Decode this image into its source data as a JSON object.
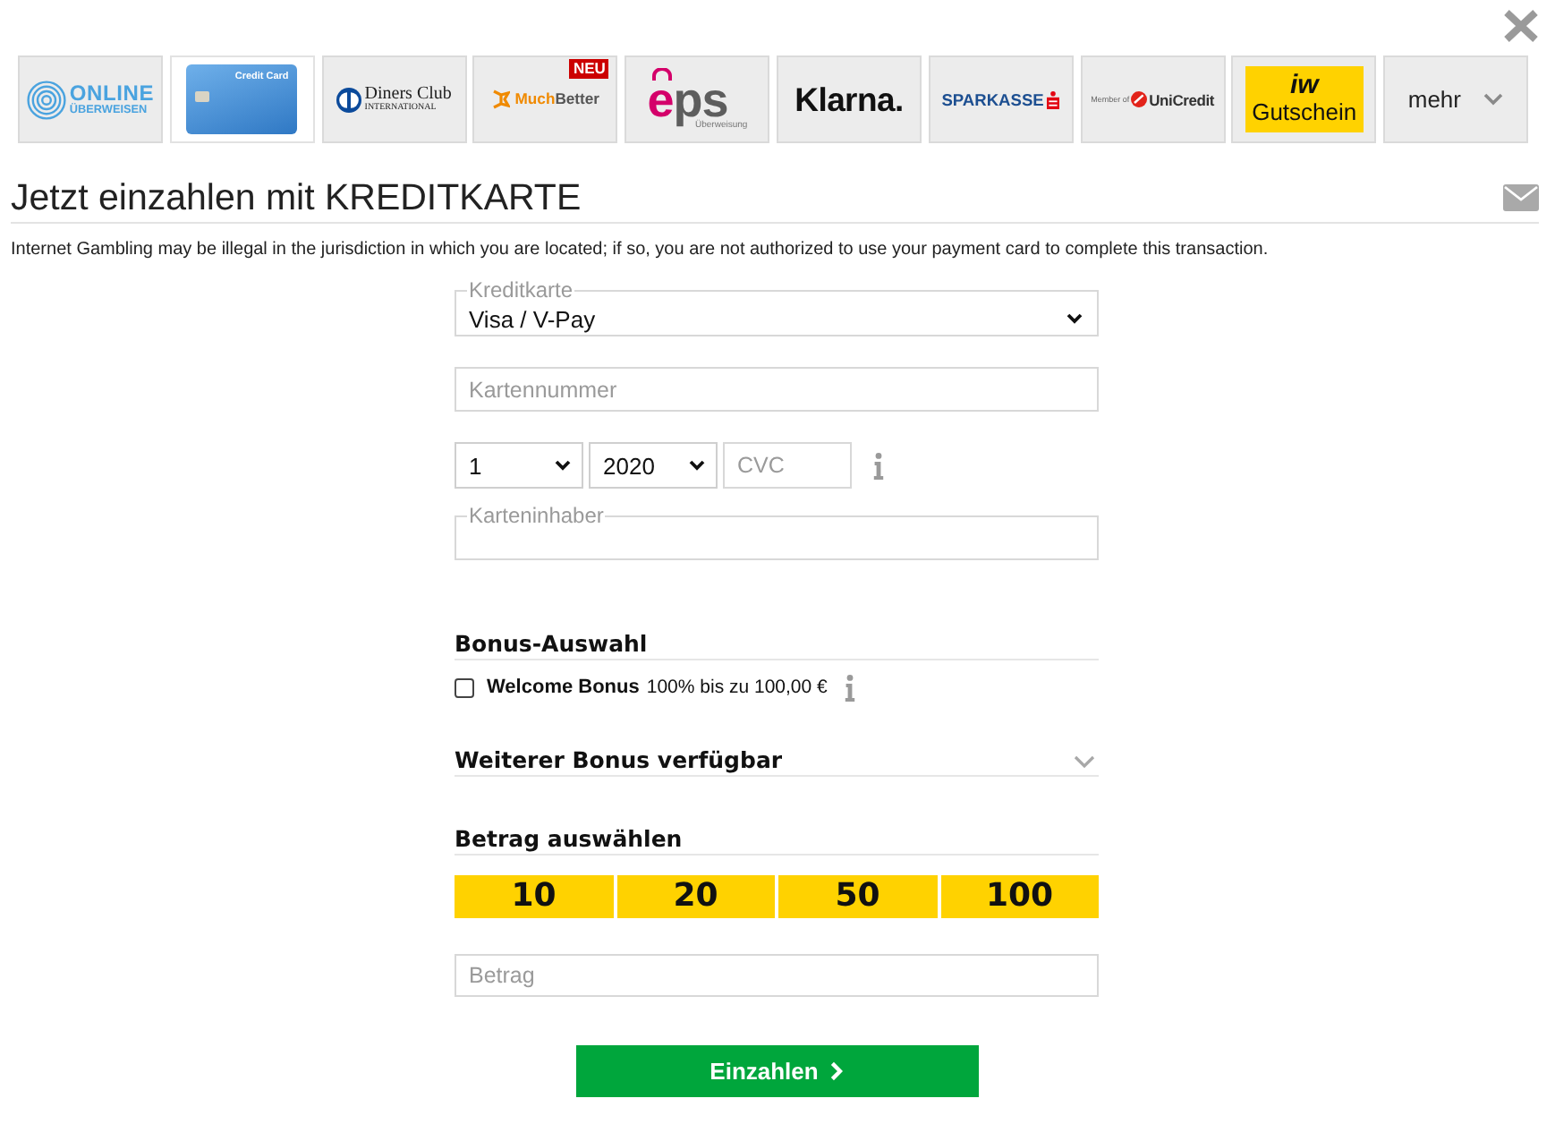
{
  "payment_methods": [
    {
      "kind": "online-transfer",
      "line_1": "ONLINE",
      "line_2": "ÜBERWEISEN",
      "selected": false
    },
    {
      "kind": "card",
      "label": "Credit Card",
      "selected": true
    },
    {
      "kind": "diners",
      "line_1": "Diners Club",
      "line_2": "INTERNATIONAL",
      "selected": false
    },
    {
      "kind": "wallet",
      "part_1": "Much",
      "part_2": "Better",
      "badge": "NEU",
      "selected": false
    },
    {
      "kind": "eps",
      "part_1": "e",
      "part_2": "ps",
      "line_2": "Überweisung",
      "selected": false
    },
    {
      "kind": "wordmark",
      "label": "Klarna.",
      "selected": false
    },
    {
      "kind": "bank",
      "label": "SPARKASSE",
      "selected": false
    },
    {
      "kind": "member",
      "prefix": "Member of",
      "label": "UniCredit",
      "selected": false
    },
    {
      "kind": "voucher",
      "line_1": "iw",
      "line_2": "Gutschein",
      "selected": false
    },
    {
      "kind": "more",
      "label": "mehr",
      "selected": false
    }
  ],
  "heading": "Jetzt einzahlen mit KREDITKARTE",
  "disclaimer": "Internet Gambling may be illegal in the jurisdiction in which you are located; if so, you are not authorized to use your payment card to complete this transaction.",
  "card_form": {
    "card_type": {
      "legend": "Kreditkarte",
      "value": "Visa / V-Pay"
    },
    "card_number": {
      "placeholder": "Kartennummer"
    },
    "expiry_month": {
      "value": "1"
    },
    "expiry_year": {
      "value": "2020"
    },
    "cvc": {
      "placeholder": "CVC"
    },
    "card_holder": {
      "legend": "Karteninhaber"
    }
  },
  "bonus": {
    "title": "Bonus-Auswahl",
    "options": [
      {
        "name": "Welcome Bonus",
        "description": "100% bis zu 100,00 €",
        "checked": false
      }
    ]
  },
  "more_bonus": {
    "title": "Weiterer Bonus verfügbar",
    "expanded": false
  },
  "amount": {
    "title": "Betrag auswählen",
    "presets": [
      {
        "label": "10",
        "selected": false
      },
      {
        "label": "20",
        "selected": false
      },
      {
        "label": "50",
        "selected": false
      },
      {
        "label": "100",
        "selected": false
      }
    ],
    "field": {
      "placeholder": "Betrag"
    }
  },
  "submit": {
    "label": "Einzahlen"
  }
}
